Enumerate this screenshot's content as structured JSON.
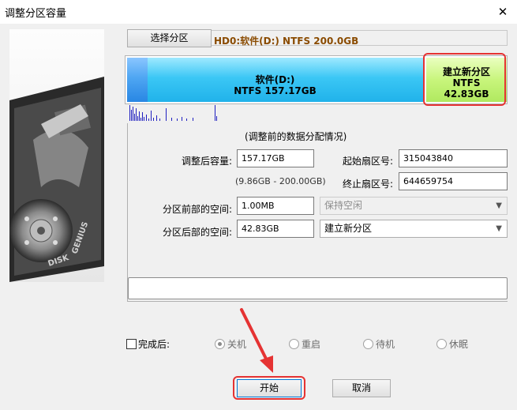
{
  "window": {
    "title": "调整分区容量",
    "close_icon": "✕"
  },
  "toolbar": {
    "select_partition_label": "选择分区",
    "disk_info": "HD0:软件(D:) NTFS 200.0GB"
  },
  "diskmap": {
    "partition_d": {
      "name": "软件(D:)",
      "info": "NTFS 157.17GB"
    },
    "partition_new": {
      "name": "建立新分区",
      "fs": "NTFS",
      "size": "42.83GB"
    }
  },
  "section": {
    "title": "(调整前的数据分配情况)"
  },
  "form": {
    "size_after_label": "调整后容量:",
    "size_after_value": "157.17GB",
    "size_range": "(9.86GB - 200.00GB)",
    "start_sector_label": "起始扇区号:",
    "start_sector_value": "315043840",
    "end_sector_label": "终止扇区号:",
    "end_sector_value": "644659754",
    "space_before_label": "分区前部的空间:",
    "space_before_value": "1.00MB",
    "space_before_option": "保持空闲",
    "space_after_label": "分区后部的空间:",
    "space_after_value": "42.83GB",
    "space_after_option": "建立新分区"
  },
  "after_complete": {
    "label": "完成后:",
    "options": [
      "关机",
      "重启",
      "待机",
      "休眠"
    ],
    "selected": "关机"
  },
  "buttons": {
    "start": "开始",
    "cancel": "取消"
  },
  "colors": {
    "highlight": "#e53333",
    "partition_d": "#20b2ea",
    "partition_new": "#b0e960",
    "disk_info_text": "#8a4b00"
  }
}
